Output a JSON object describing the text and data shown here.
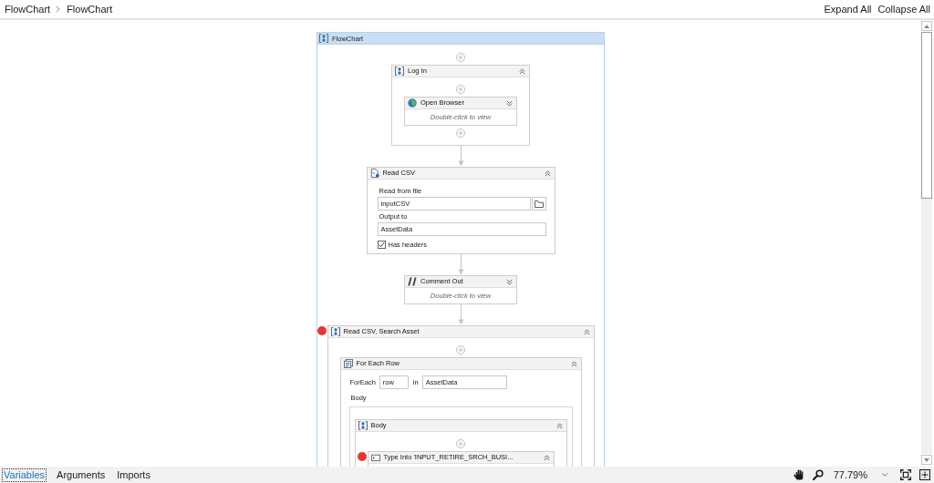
{
  "breadcrumb": [
    {
      "label": "FlowChart"
    },
    {
      "label": "FlowChart"
    }
  ],
  "header_actions": [
    "Expand All",
    "Collapse All"
  ],
  "flowchart": {
    "title": "FlowChart",
    "nodes": [
      {
        "kind": "sequence",
        "title": "Log In",
        "expanded": true,
        "breakpoint": false,
        "children": [
          {
            "kind": "browser",
            "title": "Open Browser",
            "expanded": false,
            "breakpoint": false,
            "hint": "Double-click to view"
          }
        ]
      },
      {
        "kind": "read_csv",
        "title": "Read CSV",
        "expanded": true,
        "breakpoint": false,
        "fields": [
          {
            "label": "Read from file",
            "value": "inputCSV",
            "browse": true
          },
          {
            "label": "Output to",
            "value": "AssetData",
            "browse": false
          }
        ],
        "checkbox": {
          "label": "Has headers",
          "checked": true
        }
      },
      {
        "kind": "comment",
        "title": "Comment Out",
        "expanded": false,
        "breakpoint": false,
        "hint": "Double-click to view"
      },
      {
        "kind": "sequence",
        "title": "Read CSV, Search Asset",
        "expanded": true,
        "breakpoint": true,
        "children": [
          {
            "kind": "for_each",
            "title": "For Each Row",
            "expanded": true,
            "breakpoint": false,
            "foreach_label": "ForEach",
            "item": "row",
            "in_label": "in",
            "collection": "AssetData",
            "body_label": "Body",
            "body": [
              {
                "kind": "sequence",
                "title": "Body",
                "expanded": true,
                "breakpoint": false,
                "children": [
                  {
                    "kind": "type_into",
                    "title": "Type Into 'INPUT_RETIRE_SRCH_BUSI...",
                    "expanded": true,
                    "breakpoint": true
                  }
                ]
              }
            ]
          }
        ]
      }
    ]
  },
  "bottom_bar": {
    "tabs": [
      {
        "label": "Variables",
        "selected": true
      },
      {
        "label": "Arguments",
        "selected": false
      },
      {
        "label": "Imports",
        "selected": false
      }
    ],
    "zoom": "77.79%"
  }
}
